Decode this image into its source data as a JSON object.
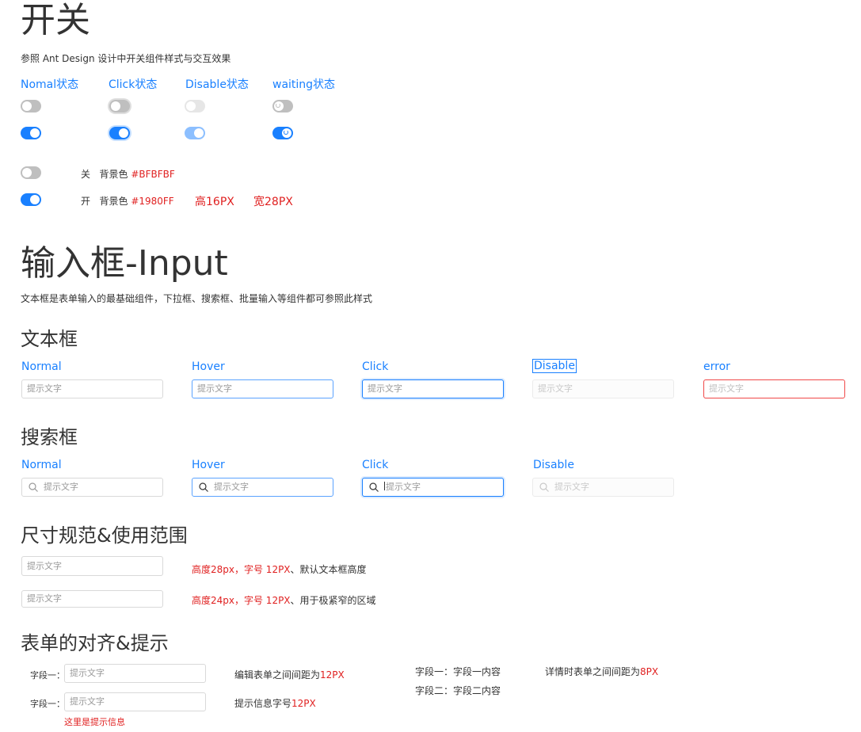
{
  "switch_section": {
    "title": "开关",
    "subtitle": "参照  Ant  Design  设计中开关组件样式与交互效果",
    "states": [
      "Nomal状态",
      "Click状态",
      "Disable状态",
      "waiting状态"
    ],
    "off_label": "关",
    "off_bg_label": "背景色",
    "off_color": "#BFBFBF",
    "on_label": "开",
    "on_bg_label": "背景色",
    "on_color": "#1980FF",
    "height_note": "高16PX",
    "width_note": "宽28PX"
  },
  "input_section": {
    "title": "输入框-Input",
    "subtitle": "文本框是表单输入的最基础组件，下拉框、搜索框、批量输入等组件都可参照此样式",
    "text_box": {
      "title": "文本框",
      "states": [
        "Normal",
        "Hover",
        "Click",
        "Disable",
        "error"
      ],
      "placeholder": "提示文字"
    },
    "search_box": {
      "title": "搜索框",
      "states": [
        "Normal",
        "Hover",
        "Click",
        "Disable"
      ],
      "placeholder": "提示文字"
    },
    "size_spec": {
      "title": "尺寸规范&使用范围",
      "placeholder": "提示文字",
      "row1_a": "高度28px，字号 12PX",
      "row1_b": "、默认文本框高度",
      "row2_a": "高度24px，字号 12PX",
      "row2_b": "、用于极紧窄的区域"
    },
    "form_align": {
      "title": "表单的对齐&提示",
      "field_label": "字段一：",
      "placeholder": "提示文字",
      "hint": "这里是提示信息",
      "edit_note_a": "编辑表单之间间距为",
      "edit_note_b": "12PX",
      "hint_note_a": "提示信息字号",
      "hint_note_b": "12PX",
      "detail_row1": "字段一：字段一内容",
      "detail_row2": "字段二：字段二内容",
      "detail_note_a": "详情时表单之间间距为",
      "detail_note_b": "8PX"
    }
  },
  "colors": {
    "primary": "#1980FF",
    "off": "#BFBFBF",
    "error": "#E02020"
  }
}
